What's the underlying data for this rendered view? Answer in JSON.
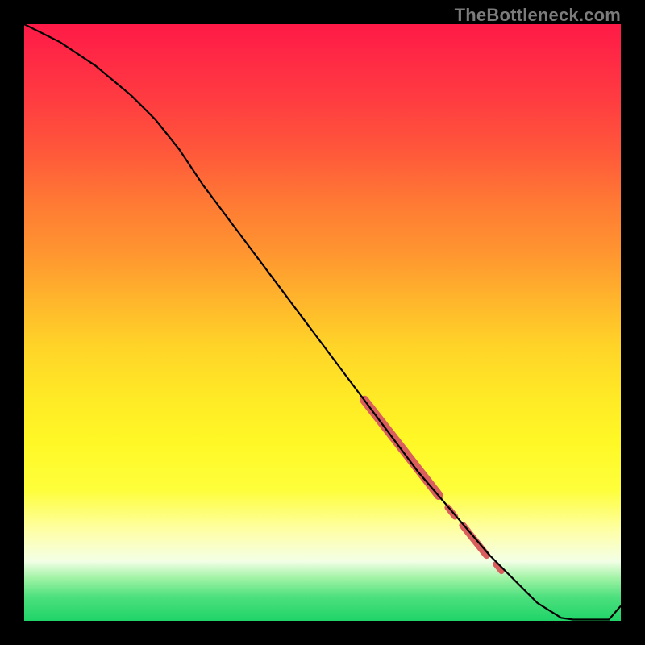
{
  "watermark": "TheBottleneck.com",
  "chart_data": {
    "type": "line",
    "title": "",
    "xlabel": "",
    "ylabel": "",
    "xlim": [
      0,
      100
    ],
    "ylim": [
      0,
      100
    ],
    "series": [
      {
        "name": "curve",
        "x": [
          0,
          6,
          12,
          18,
          22,
          26,
          30,
          36,
          42,
          48,
          54,
          60,
          66,
          72,
          78,
          82,
          86,
          90,
          92,
          98,
          100
        ],
        "values": [
          100,
          97,
          93,
          88,
          84,
          79,
          73,
          65,
          57,
          49,
          41,
          33,
          25,
          18,
          11,
          7,
          3,
          0.5,
          0.2,
          0.2,
          2.5
        ]
      }
    ],
    "highlight_segments": [
      {
        "x0": 57,
        "y0": 37,
        "x1": 69.5,
        "y1": 21,
        "thick": 11
      },
      {
        "x0": 71,
        "y0": 19,
        "x1": 72.2,
        "y1": 17.5,
        "thick": 8
      },
      {
        "x0": 73.5,
        "y0": 16,
        "x1": 77.5,
        "y1": 11,
        "thick": 9
      },
      {
        "x0": 79,
        "y0": 9.5,
        "x1": 80,
        "y1": 8.3,
        "thick": 7
      }
    ],
    "colors": {
      "line": "#000000",
      "highlight": "#db5e5e",
      "bg_top": "#ff1a47",
      "bg_bottom": "#1fd468",
      "watermark": "#7b7b7b"
    }
  }
}
